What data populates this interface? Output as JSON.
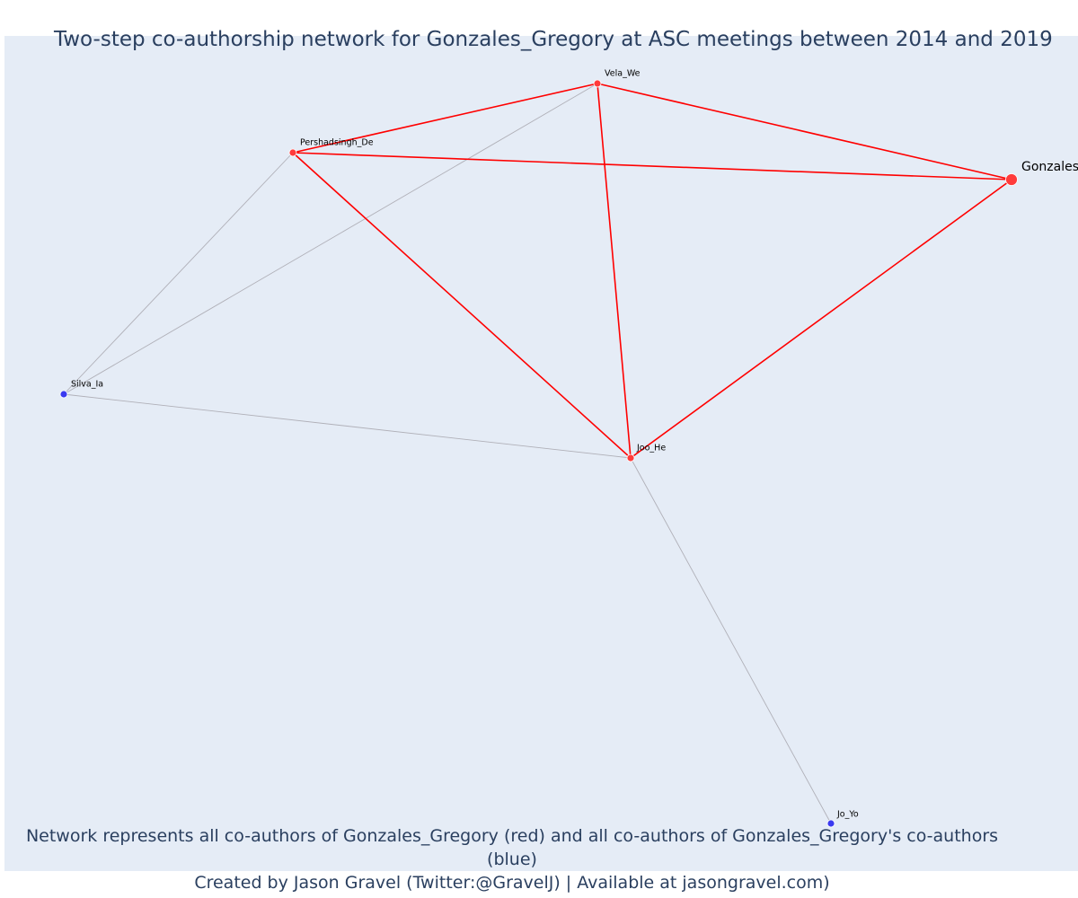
{
  "title": "Two-step co-authorship network for Gonzales_Gregory at ASC meetings between 2014 and 2019",
  "footer": {
    "line1": "Network represents all co-authors of Gonzales_Gregory (red) and all co-authors of Gonzales_Gregory's co-authors (blue)",
    "line2": "Created by Jason Gravel (Twitter:@GravelJ) | Available at jasongravel.com)"
  },
  "colors": {
    "background": "#e5ecf6",
    "direct_edge": "#ff0000",
    "indirect_edge": "#b0b0b8",
    "direct_node": "#ff3b3b",
    "indirect_node": "#3a3af0",
    "title_text": "#2a3f5f"
  },
  "network": {
    "nodes": [
      {
        "id": "Gonzales_Gregory",
        "label": "Gonzales_Gregory",
        "group": "focal"
      },
      {
        "id": "Vela_We",
        "label": "Vela_We",
        "group": "co-author"
      },
      {
        "id": "Pershadsingh_De",
        "label": "Pershadsingh_De",
        "group": "co-author"
      },
      {
        "id": "Joo_He",
        "label": "Joo_He",
        "group": "co-author"
      },
      {
        "id": "Silva_Ia",
        "label": "Silva_Ia",
        "group": "second-step"
      },
      {
        "id": "Jo_Yo",
        "label": "Jo_Yo",
        "group": "second-step"
      }
    ],
    "edges": [
      {
        "source": "Pershadsingh_De",
        "target": "Silva_Ia",
        "type": "indirect"
      },
      {
        "source": "Vela_We",
        "target": "Silva_Ia",
        "type": "indirect"
      },
      {
        "source": "Silva_Ia",
        "target": "Joo_He",
        "type": "indirect"
      },
      {
        "source": "Joo_He",
        "target": "Jo_Yo",
        "type": "indirect"
      },
      {
        "source": "Pershadsingh_De",
        "target": "Vela_We",
        "type": "direct"
      },
      {
        "source": "Vela_We",
        "target": "Gonzales_Gregory",
        "type": "direct"
      },
      {
        "source": "Pershadsingh_De",
        "target": "Gonzales_Gregory",
        "type": "direct"
      },
      {
        "source": "Vela_We",
        "target": "Joo_He",
        "type": "direct"
      },
      {
        "source": "Pershadsingh_De",
        "target": "Joo_He",
        "type": "direct"
      },
      {
        "source": "Joo_He",
        "target": "Gonzales_Gregory",
        "type": "direct"
      }
    ]
  }
}
